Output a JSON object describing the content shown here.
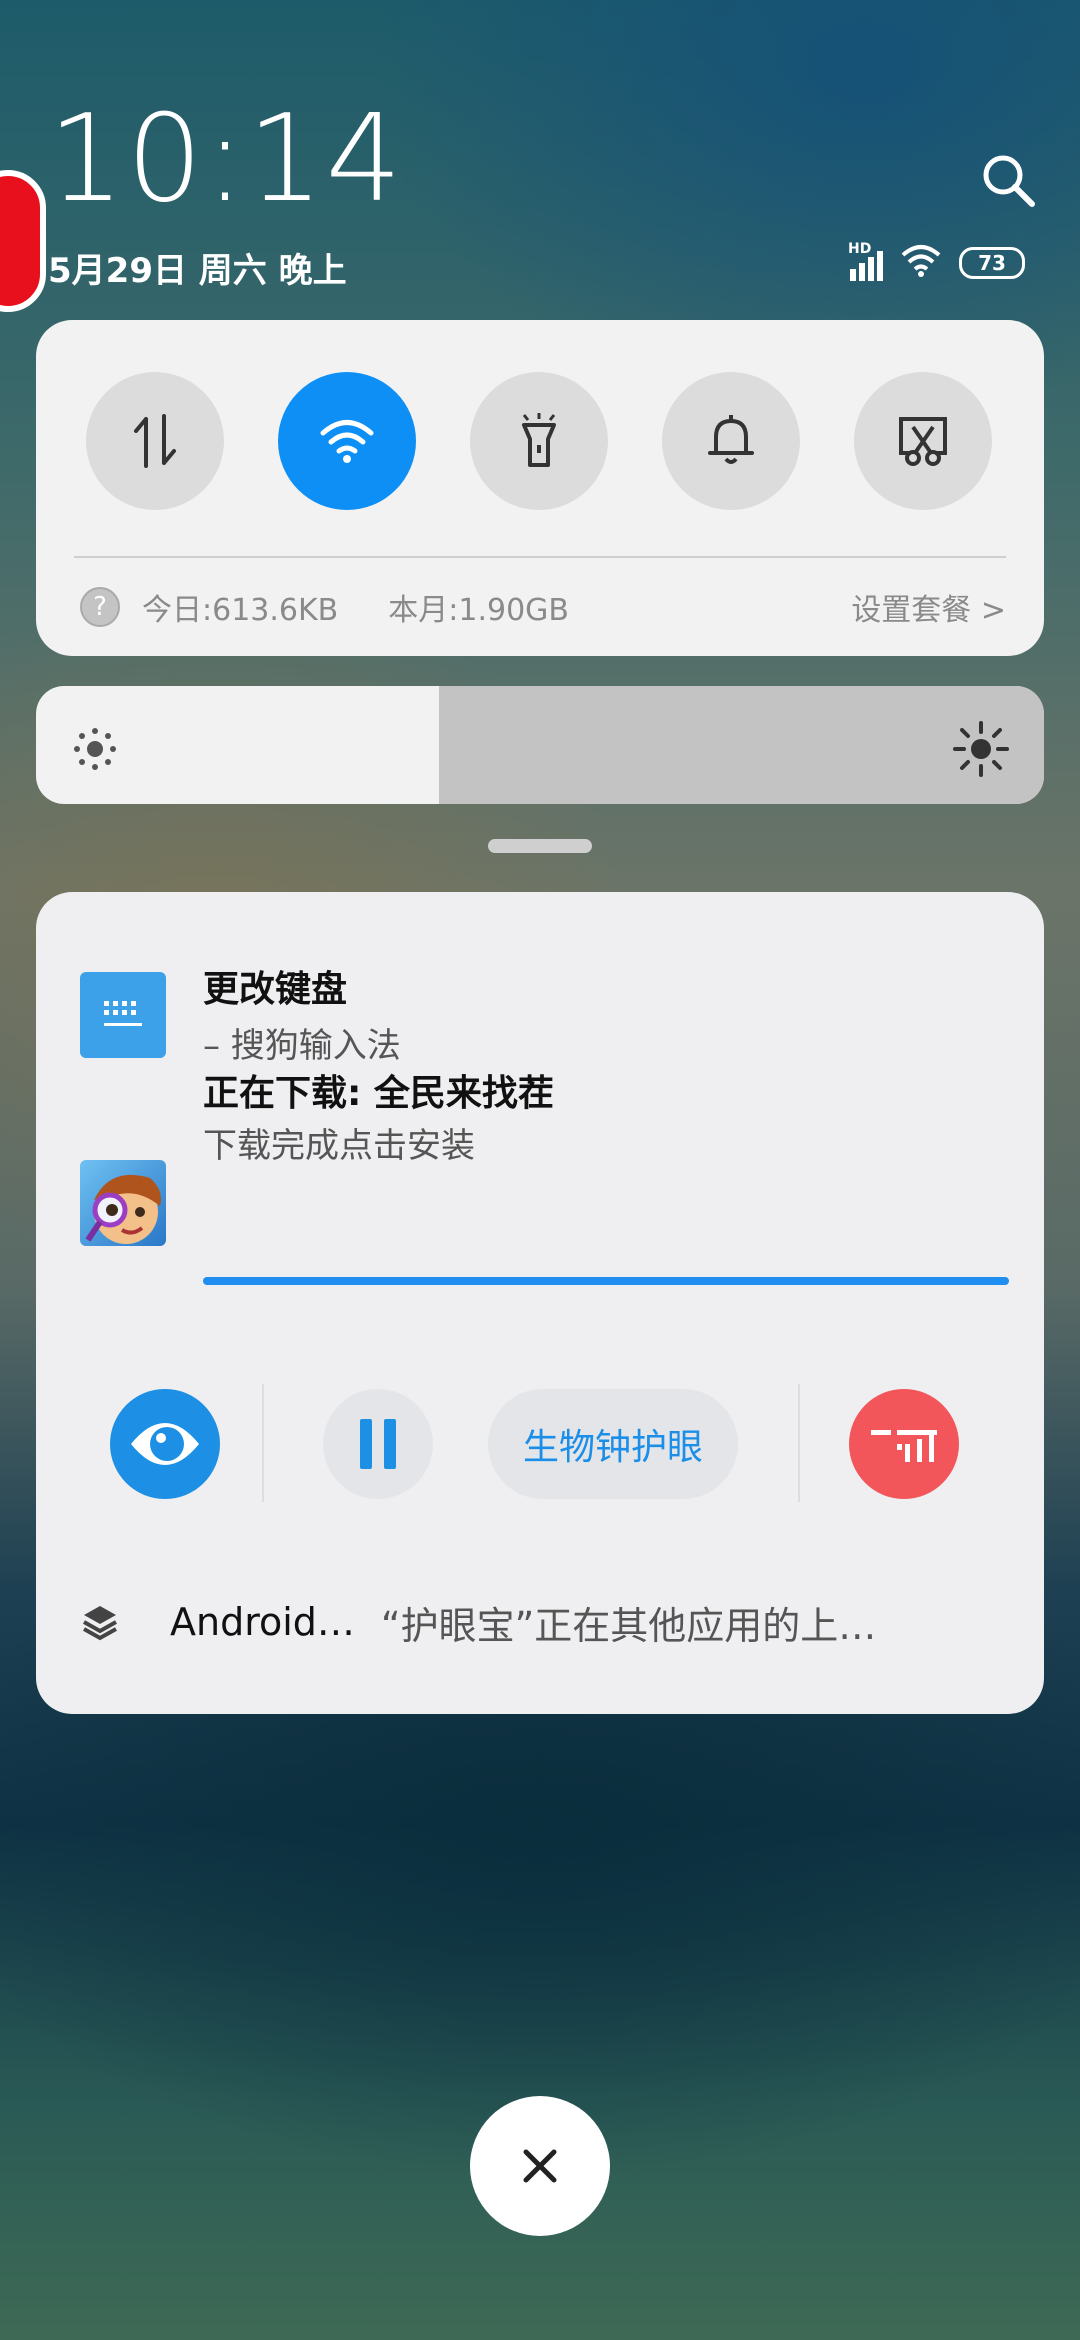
{
  "status": {
    "time": "10:14",
    "date": "5月29日 周六 晚上",
    "battery": "73",
    "network_label": "HD"
  },
  "quick_settings": {
    "toggles": [
      {
        "icon": "data-transfer-icon",
        "active": false
      },
      {
        "icon": "wifi-icon",
        "active": true
      },
      {
        "icon": "flashlight-icon",
        "active": false
      },
      {
        "icon": "bell-icon",
        "active": false
      },
      {
        "icon": "screenshot-icon",
        "active": false
      }
    ],
    "usage_today": "今日:613.6KB",
    "usage_month": "本月:1.90GB",
    "plan_link": "设置套餐 >"
  },
  "brightness": {
    "level_percent": 40
  },
  "notifications": [
    {
      "title": "更改键盘",
      "subtitle": "– 搜狗输入法",
      "icon": "keyboard-icon"
    },
    {
      "title": "正在下载: 全民来找茬",
      "subtitle": "下载完成点击安装",
      "icon": "game-app-icon",
      "progress": 1.0
    }
  ],
  "eye_protect": {
    "bio_button": "生物钟护眼",
    "footer_app": "Android…",
    "footer_text": "“护眼宝”正在其他应用的上…"
  },
  "colors": {
    "accent": "#0d8ff5",
    "close_red": "#f2555a",
    "card_bg": "#f2f2f3"
  }
}
